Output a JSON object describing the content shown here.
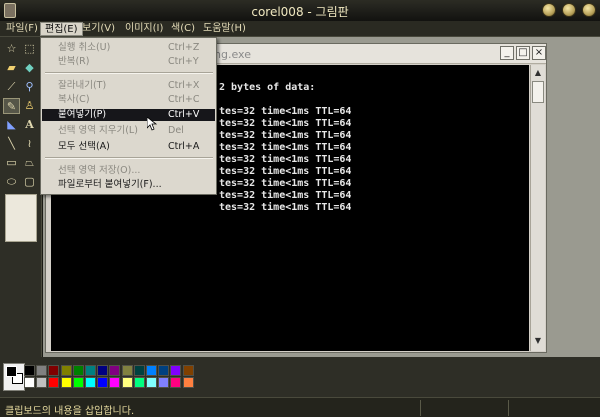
{
  "window": {
    "title": "corel008 - 그림판"
  },
  "menubar": [
    {
      "label": "파일(F)",
      "active": false
    },
    {
      "label": "편집(E)",
      "active": true
    },
    {
      "label": "보기(V)",
      "active": false
    },
    {
      "label": "이미지(I)",
      "active": false
    },
    {
      "label": "색(C)",
      "active": false
    },
    {
      "label": "도움말(H)",
      "active": false
    }
  ],
  "edit_menu": {
    "items": [
      {
        "label": "실행 취소(U)",
        "shortcut": "Ctrl+Z",
        "enabled": false
      },
      {
        "label": "반복(R)",
        "shortcut": "Ctrl+Y",
        "enabled": false
      },
      {
        "label": "잘라내기(T)",
        "shortcut": "Ctrl+X",
        "enabled": false
      },
      {
        "label": "복사(C)",
        "shortcut": "Ctrl+C",
        "enabled": false
      },
      {
        "label": "붙여넣기(P)",
        "shortcut": "Ctrl+V",
        "enabled": true,
        "highlighted": true
      },
      {
        "label": "선택 영역 지우기(L)",
        "shortcut": "Del",
        "enabled": false
      },
      {
        "label": "모두 선택(A)",
        "shortcut": "Ctrl+A",
        "enabled": true
      },
      {
        "label": "선택 영역 저장(O)...",
        "shortcut": "",
        "enabled": false
      },
      {
        "label": "파일로부터 붙여넣기(F)...",
        "shortcut": "",
        "enabled": true
      }
    ]
  },
  "inner_window": {
    "title": "ng.exe"
  },
  "console": {
    "lines": [
      "2 bytes of data:",
      "",
      "tes=32 time<1ms TTL=64",
      "tes=32 time<1ms TTL=64",
      "tes=32 time<1ms TTL=64",
      "tes=32 time<1ms TTL=64",
      "tes=32 time<1ms TTL=64",
      "tes=32 time<1ms TTL=64",
      "tes=32 time<1ms TTL=64",
      "tes=32 time<1ms TTL=64",
      "tes=32 time<1ms TTL=64"
    ]
  },
  "tools": [
    "free-select-icon",
    "rect-select-icon",
    "eraser-icon",
    "fill-icon",
    "color-picker-icon",
    "magnifier-icon",
    "pencil-icon",
    "brush-icon",
    "airbrush-icon",
    "text-icon",
    "line-icon",
    "curve-icon",
    "rectangle-icon",
    "polygon-icon",
    "ellipse-icon",
    "rounded-rect-icon"
  ],
  "palette": {
    "top_row": [
      "#000000",
      "#808080",
      "#800000",
      "#808000",
      "#008000",
      "#008080",
      "#000080",
      "#800080",
      "#808040",
      "#004040",
      "#0080ff",
      "#004080",
      "#8000ff",
      "#804000"
    ],
    "bottom_row": [
      "#ffffff",
      "#c0c0c0",
      "#ff0000",
      "#ffff00",
      "#00ff00",
      "#00ffff",
      "#0000ff",
      "#ff00ff",
      "#ffff80",
      "#00ff80",
      "#80ffff",
      "#8080ff",
      "#ff0080",
      "#ff8040"
    ]
  },
  "status": {
    "text": "클립보드의 내용을 삽입합니다."
  }
}
